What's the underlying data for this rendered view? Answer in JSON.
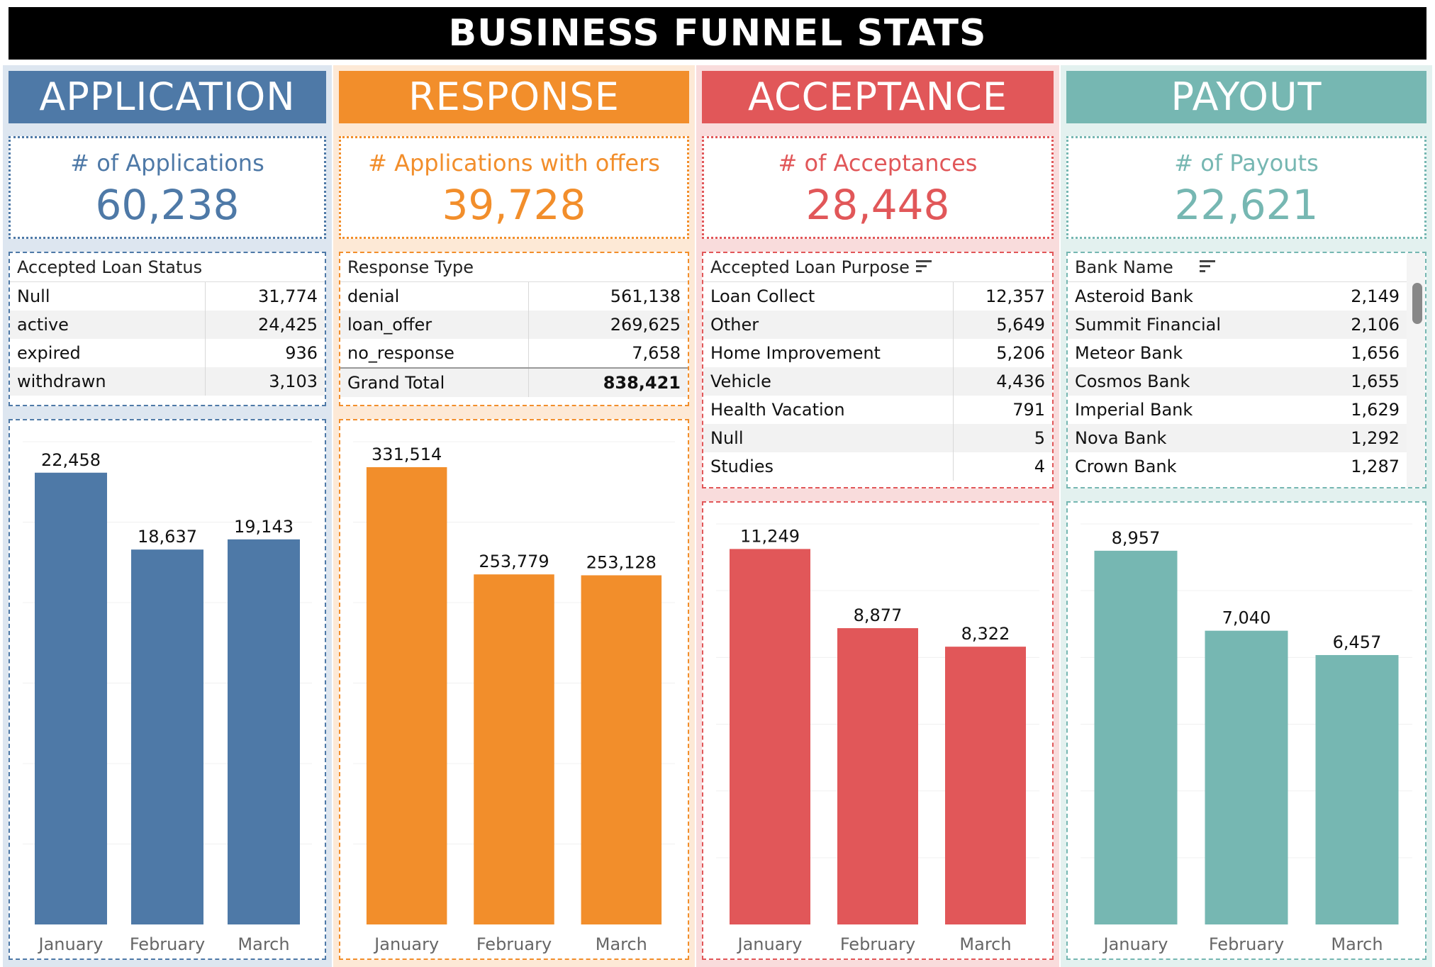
{
  "title": "BUSINESS FUNNEL STATS",
  "colors": {
    "application": "#4e79a7",
    "response": "#f28e2b",
    "acceptance": "#e15759",
    "payout": "#76b7b2"
  },
  "stages": {
    "application": {
      "header": "APPLICATION",
      "kpi_label": "# of Applications",
      "kpi_value": "60,238",
      "table": {
        "header": "Accepted Loan Status",
        "rows": [
          {
            "label": "Null",
            "value": "31,774"
          },
          {
            "label": "active",
            "value": "24,425"
          },
          {
            "label": "expired",
            "value": "936"
          },
          {
            "label": "withdrawn",
            "value": "3,103"
          }
        ]
      }
    },
    "response": {
      "header": "RESPONSE",
      "kpi_label": "# Applications with offers",
      "kpi_value": "39,728",
      "table": {
        "header": "Response Type",
        "rows": [
          {
            "label": "denial",
            "value": "561,138"
          },
          {
            "label": "loan_offer",
            "value": "269,625"
          },
          {
            "label": "no_response",
            "value": "7,658"
          },
          {
            "label": "Grand Total",
            "value": "838,421"
          }
        ]
      }
    },
    "acceptance": {
      "header": "ACCEPTANCE",
      "kpi_label": "# of Acceptances",
      "kpi_value": "28,448",
      "table": {
        "header": "Accepted Loan Purpose",
        "sort_icon": "sort-icon",
        "rows": [
          {
            "label": "Loan Collect",
            "value": "12,357"
          },
          {
            "label": "Other",
            "value": "5,649"
          },
          {
            "label": "Home Improvement",
            "value": "5,206"
          },
          {
            "label": "Vehicle",
            "value": "4,436"
          },
          {
            "label": "Health Vacation",
            "value": "791"
          },
          {
            "label": "Null",
            "value": "5"
          },
          {
            "label": "Studies",
            "value": "4"
          }
        ]
      }
    },
    "payout": {
      "header": "PAYOUT",
      "kpi_label": "# of Payouts",
      "kpi_value": "22,621",
      "table": {
        "header": "Bank Name",
        "sort_icon": "sort-icon",
        "rows": [
          {
            "label": "Asteroid Bank",
            "value": "2,149"
          },
          {
            "label": "Summit Financial",
            "value": "2,106"
          },
          {
            "label": "Meteor Bank",
            "value": "1,656"
          },
          {
            "label": "Cosmos Bank",
            "value": "1,655"
          },
          {
            "label": "Imperial Bank",
            "value": "1,629"
          },
          {
            "label": "Nova Bank",
            "value": "1,292"
          },
          {
            "label": "Crown Bank",
            "value": "1,287"
          }
        ]
      }
    }
  },
  "chart_data": [
    {
      "type": "bar",
      "categories": [
        "January",
        "February",
        "March"
      ],
      "values": [
        22458,
        18637,
        19143
      ],
      "data_labels": [
        "22,458",
        "18,637",
        "19,143"
      ],
      "ylim": [
        0,
        24000
      ]
    },
    {
      "type": "bar",
      "categories": [
        "January",
        "February",
        "March"
      ],
      "values": [
        331514,
        253779,
        253128
      ],
      "data_labels": [
        "331,514",
        "253,779",
        "253,128"
      ],
      "ylim": [
        0,
        350000
      ]
    },
    {
      "type": "bar",
      "categories": [
        "January",
        "February",
        "March"
      ],
      "values": [
        11249,
        8877,
        8322
      ],
      "data_labels": [
        "11,249",
        "8,877",
        "8,322"
      ],
      "ylim": [
        0,
        12000
      ]
    },
    {
      "type": "bar",
      "categories": [
        "January",
        "February",
        "March"
      ],
      "values": [
        8957,
        7040,
        6457
      ],
      "data_labels": [
        "8,957",
        "7,040",
        "6,457"
      ],
      "ylim": [
        0,
        9600
      ]
    }
  ]
}
